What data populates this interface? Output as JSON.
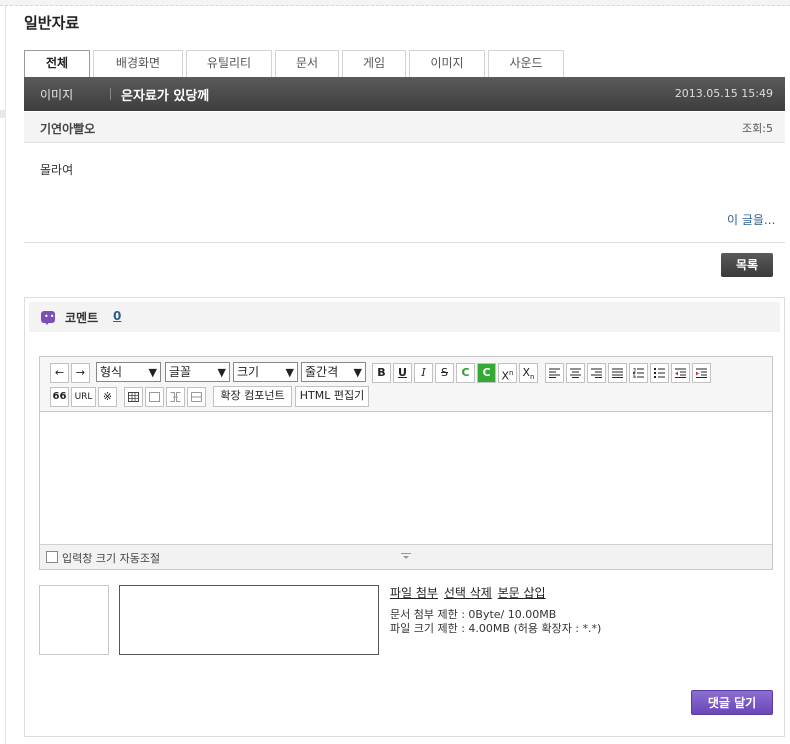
{
  "page_title": "일반자료",
  "tabs": [
    {
      "label": "전체",
      "active": true
    },
    {
      "label": "배경화면",
      "active": false
    },
    {
      "label": "유틸리티",
      "active": false
    },
    {
      "label": "문서",
      "active": false
    },
    {
      "label": "게임",
      "active": false
    },
    {
      "label": "이미지",
      "active": false
    },
    {
      "label": "사운드",
      "active": false
    }
  ],
  "post": {
    "category": "이미지",
    "title": "은자료가 있당께",
    "date": "2013.05.15 15:49",
    "author": "기연아빨오",
    "views": "조회:5",
    "body": "몰라여",
    "this_post_link": "이 글을..."
  },
  "list_button": "목록",
  "comments": {
    "label": "코멘트",
    "count": "0"
  },
  "editor": {
    "arrow_left": "←",
    "arrow_right": "→",
    "format_select": "형식",
    "font_select": "글꼴",
    "size_select": "크기",
    "line_height_select": "줄간격",
    "bold": "B",
    "underline": "U",
    "italic": "I",
    "strike": "S",
    "color": "C",
    "bg_color": "C",
    "superscript": "X",
    "subscript": "X",
    "quote": "66",
    "url": "URL",
    "special_char": "※",
    "extension_component": "확장 컴포넌트",
    "html_editor": "HTML 편집기",
    "autosize_label": "입력창 크기 자동조절"
  },
  "attachments": {
    "attach": "파일 첨부",
    "delete": "선택 삭제",
    "insert": "본문 삽입",
    "doc_limit": "문서 첨부 제한 : 0Byte/ 10.00MB",
    "file_limit": "파일 크기 제한 : 4.00MB (허용 확장자 : *.*)"
  },
  "submit_button": "댓글 달기",
  "colors": {
    "post_bar": "#464646",
    "link": "#2c5d8f",
    "submit": "#7255c4",
    "color_green": "#2a9d2a",
    "bg_color_green": "#33aa33"
  },
  "icons": {
    "comment": "comment-bubble-icon",
    "align_left": "align-left-icon",
    "align_center": "align-center-icon",
    "align_right": "align-right-icon",
    "align_justify": "align-justify-icon",
    "ordered_list": "ordered-list-icon",
    "unordered_list": "unordered-list-icon",
    "outdent": "outdent-icon",
    "indent": "indent-icon",
    "table": "table-icon",
    "cell": "cell-icon",
    "merge": "merge-cells-icon",
    "split": "split-cells-icon",
    "resize": "resize-handle-icon"
  }
}
